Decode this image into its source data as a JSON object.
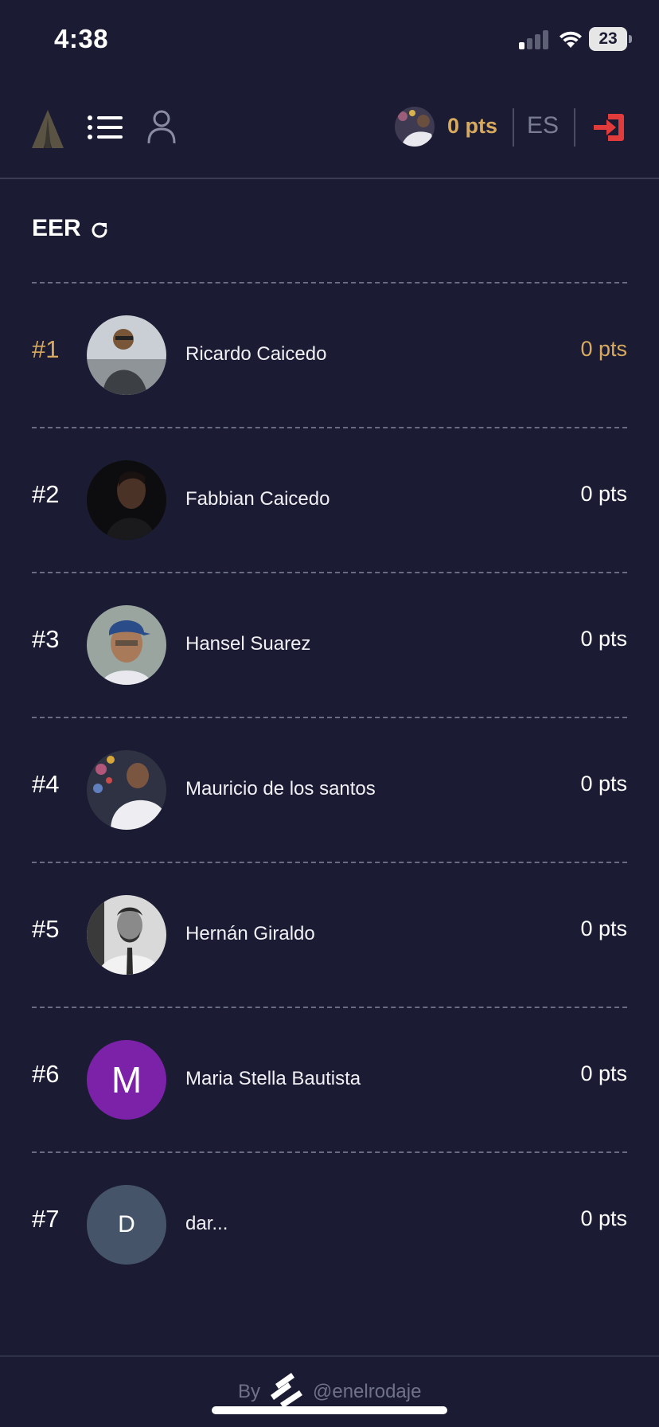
{
  "status_bar": {
    "time": "4:38",
    "battery": "23"
  },
  "header": {
    "points": "0 pts",
    "language": "ES",
    "icons": [
      "logo-icon",
      "list-icon",
      "user-icon",
      "logout-icon"
    ]
  },
  "board": {
    "title": "EER"
  },
  "leaderboard": [
    {
      "rank": "#1",
      "name": "Ricardo Caicedo",
      "points": "0 pts"
    },
    {
      "rank": "#2",
      "name": "Fabbian Caicedo",
      "points": "0 pts"
    },
    {
      "rank": "#3",
      "name": "Hansel Suarez",
      "points": "0 pts"
    },
    {
      "rank": "#4",
      "name": "Mauricio de los santos",
      "points": "0 pts"
    },
    {
      "rank": "#5",
      "name": "Hernán Giraldo",
      "points": "0 pts"
    },
    {
      "rank": "#6",
      "name": "Maria Stella Bautista",
      "points": "0 pts",
      "initial": "M",
      "avatar_color": "#7b22a8"
    },
    {
      "rank": "#7",
      "name": "dar...",
      "points": "0 pts",
      "initial": "D",
      "avatar_color": "#46546a"
    }
  ],
  "footer": {
    "by": "By",
    "handle": "@enelrodaje"
  },
  "colors": {
    "background": "#1b1c33",
    "accent": "#d8aa5f",
    "logout": "#e23b3b"
  }
}
